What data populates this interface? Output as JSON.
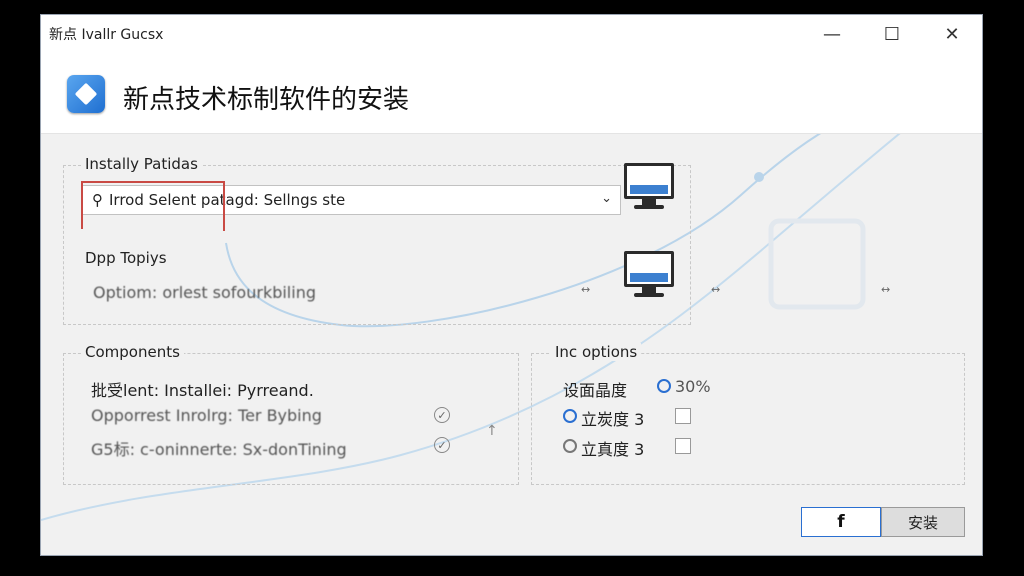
{
  "window": {
    "title": "新点 Ivallr Gucsx",
    "controls": {
      "minimize": "—",
      "maximize": "☐",
      "close": "✕"
    }
  },
  "header": {
    "title": "新点技术标制软件的安装"
  },
  "install_path": {
    "group_label": "Instally Patidas",
    "dropdown_value": "Irrod  Selent patagd: Sellngs ste",
    "pin_icon": "map-pin-icon",
    "chevron": "⌄"
  },
  "dpp": {
    "label": "Dpp Topiys",
    "option_text": "Optiom: orlest sofourkbiling",
    "arrow_text": "↔"
  },
  "components": {
    "label": "Components",
    "items": [
      {
        "text": "批受lent: Installei: Pyrreand."
      },
      {
        "text": "Opporrest Inrolrg: Ter Bybing"
      },
      {
        "text": "G5标: c-oninnerte: Sx-donTining"
      }
    ]
  },
  "inc_options": {
    "label": "Inc options",
    "rows": [
      {
        "label": "设面晶度",
        "value": "30%"
      },
      {
        "label": "立炭度 3"
      },
      {
        "label": "立真度 3"
      }
    ]
  },
  "buttons": {
    "primary": "f",
    "secondary": "安装"
  },
  "colors": {
    "accent": "#2a6fd1",
    "highlight": "#c94a44",
    "curve": "#b9d4ea"
  }
}
